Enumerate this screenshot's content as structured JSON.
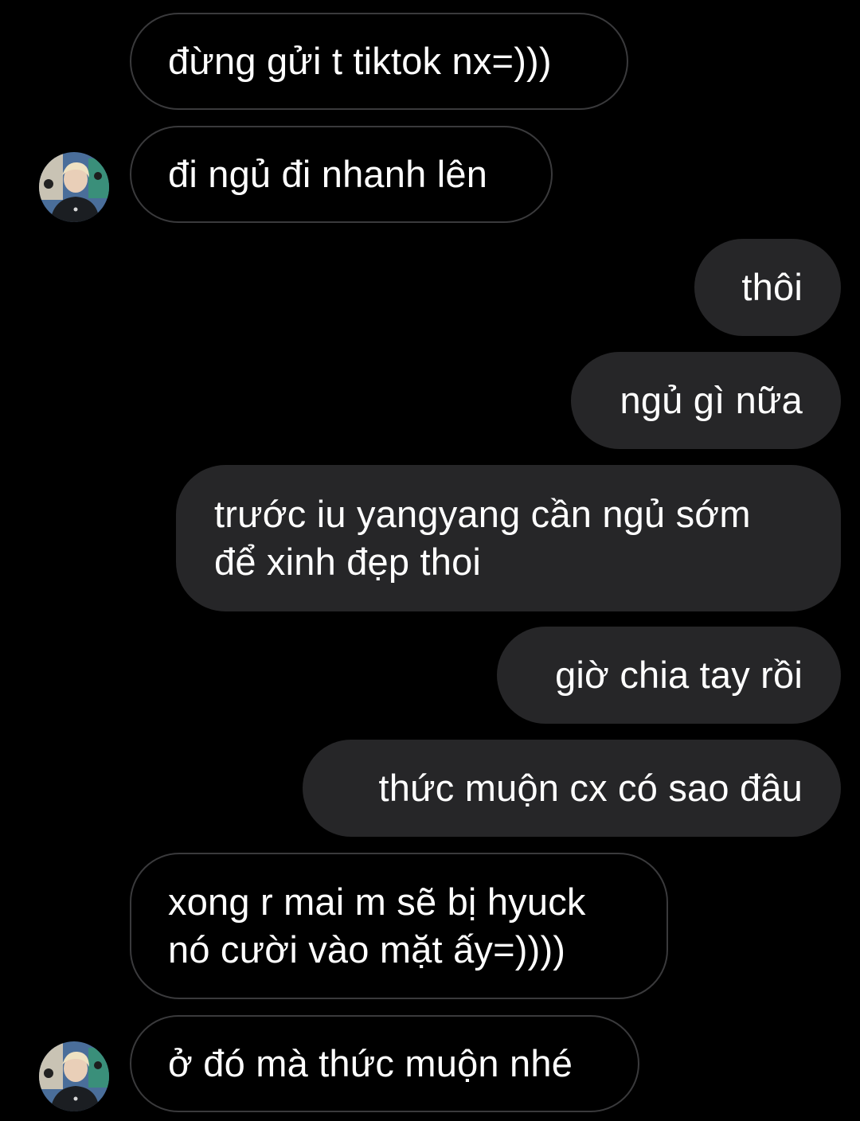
{
  "conversation": {
    "messages": [
      {
        "direction": "incoming",
        "lines": [
          "đừng gửi t tiktok nx=)))"
        ]
      },
      {
        "direction": "incoming",
        "lines": [
          "đi ngủ đi nhanh lên"
        ]
      },
      {
        "direction": "outgoing",
        "lines": [
          "thôi"
        ]
      },
      {
        "direction": "outgoing",
        "lines": [
          "ngủ gì nữa"
        ]
      },
      {
        "direction": "outgoing",
        "lines": [
          "trước iu yangyang cần ngủ sớm",
          "để xinh đẹp thoi"
        ]
      },
      {
        "direction": "outgoing",
        "lines": [
          "giờ chia tay rồi"
        ]
      },
      {
        "direction": "outgoing",
        "lines": [
          "thức muộn cx có sao đâu"
        ]
      },
      {
        "direction": "incoming",
        "lines": [
          "xong r mai m sẽ bị hyuck",
          "nó cười vào mặt ấy=))))"
        ]
      },
      {
        "direction": "incoming",
        "lines": [
          "ở đó mà thức muộn nhé"
        ]
      }
    ]
  },
  "colors": {
    "background": "#000000",
    "incoming_border": "#3a3a3c",
    "outgoing_fill": "#262628",
    "text": "#ffffff"
  }
}
